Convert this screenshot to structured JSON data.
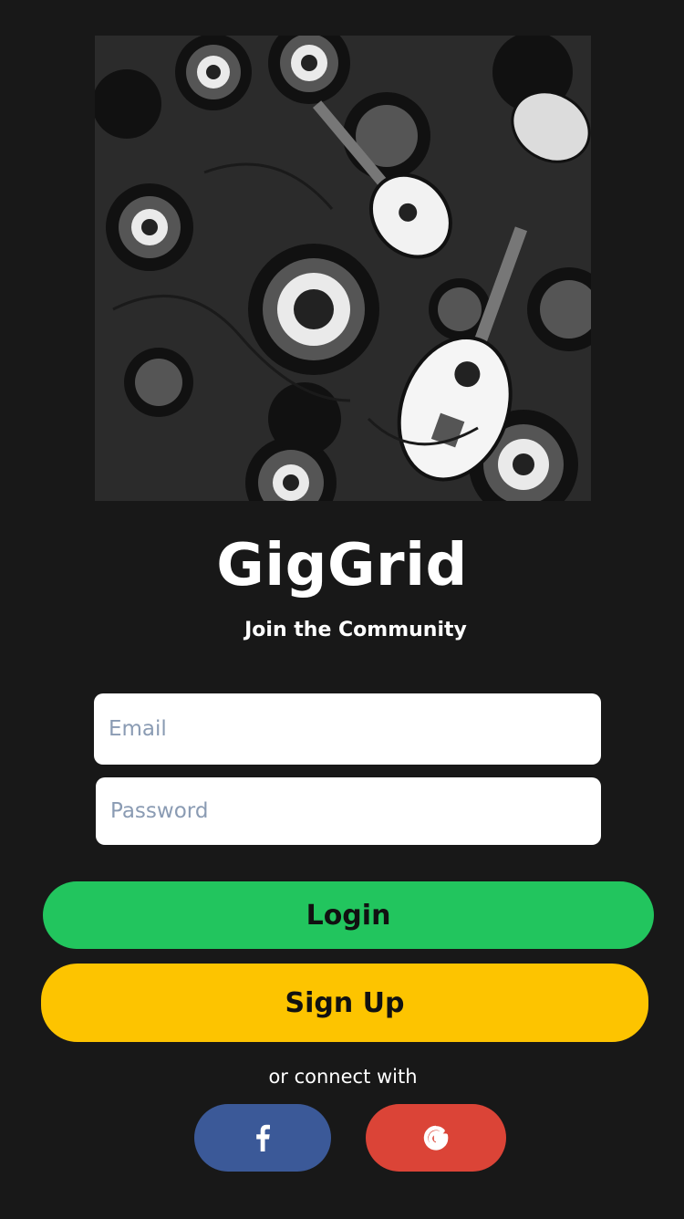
{
  "app": {
    "title": "GigGrid",
    "subtitle": "Join the Community"
  },
  "hero": {
    "description_icon": "music-collage-image"
  },
  "form": {
    "email_placeholder": "Email",
    "password_placeholder": "Password"
  },
  "buttons": {
    "login_label": "Login",
    "signup_label": "Sign Up"
  },
  "social": {
    "connect_text": "or connect with",
    "facebook_icon": "facebook-icon",
    "google_icon": "google-icon"
  },
  "colors": {
    "background": "#181818",
    "login": "#22c55e",
    "signup": "#fdc400",
    "facebook": "#3b5998",
    "google": "#db4437"
  }
}
